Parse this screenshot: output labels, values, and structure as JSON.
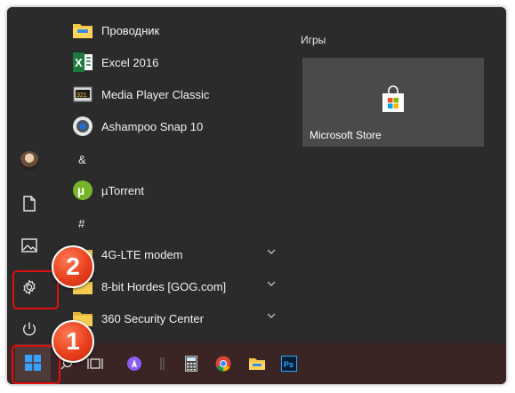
{
  "apps": [
    {
      "label": "Проводник",
      "icon": "folder-icon",
      "expandable": false
    },
    {
      "label": "Excel 2016",
      "icon": "excel-icon",
      "expandable": false
    },
    {
      "label": "Media Player Classic",
      "icon": "media-player-icon",
      "expandable": false
    },
    {
      "label": "Ashampoo Snap 10",
      "icon": "camera-icon",
      "expandable": false
    },
    {
      "label": "µTorrent",
      "icon": "utorrent-icon",
      "expandable": false
    },
    {
      "label": "4G-LTE modem",
      "icon": "folder-icon",
      "expandable": true
    },
    {
      "label": "8-bit Hordes [GOG.com]",
      "icon": "folder-icon",
      "expandable": true
    },
    {
      "label": "360 Security Center",
      "icon": "folder-icon",
      "expandable": true
    }
  ],
  "section_letters": [
    "&",
    "#"
  ],
  "tiles": {
    "group_title": "Игры",
    "store_label": "Microsoft Store"
  },
  "rail_icons": [
    "user-avatar",
    "documents-icon",
    "pictures-icon",
    "settings-icon",
    "power-icon"
  ],
  "taskbar_icons": [
    "windows-start-icon",
    "search-icon",
    "task-view-icon",
    "alice-icon",
    "calculator-icon",
    "chrome-icon",
    "explorer-icon",
    "photoshop-icon"
  ],
  "photoshop_label": "Ps",
  "callouts": [
    "1",
    "2"
  ],
  "colors": {
    "menu_bg": "#2b2b2b",
    "taskbar_bg": "#3b2424",
    "tile_bg": "#4a4a4a",
    "callout_red": "#e8401c",
    "highlight_border": "#e01010",
    "windows_blue": "#1e90ff"
  }
}
